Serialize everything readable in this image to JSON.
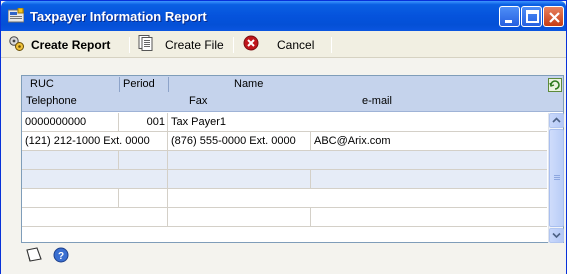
{
  "window": {
    "title": "Taxpayer Information Report"
  },
  "toolbar": {
    "create_report_label": "Create Report",
    "create_file_label": "Create File",
    "cancel_label": "Cancel"
  },
  "grid": {
    "headers": {
      "row1": {
        "ruc": "RUC",
        "period": "Period",
        "name": "Name"
      },
      "row2": {
        "telephone": "Telephone",
        "fax": "Fax",
        "email": "e-mail"
      }
    },
    "record": {
      "ruc": "0000000000",
      "period": "001",
      "name": "Tax Payer1",
      "telephone": "(121) 212-1000  Ext. 0000",
      "fax": "(876) 555-0000  Ext. 0000",
      "email": "ABC@Arix.com"
    }
  },
  "icons": {
    "app": "report-icon",
    "create_report": "gears-icon",
    "create_file": "document-icon",
    "cancel": "cancel-icon",
    "expand": "expand-icon",
    "note": "note-icon",
    "help": "help-icon"
  },
  "colors": {
    "titlebar": "#0553dc",
    "grid_header": "#c5d3ec",
    "alt_row": "#e6ecf7",
    "cancel_red": "#c0161c"
  }
}
